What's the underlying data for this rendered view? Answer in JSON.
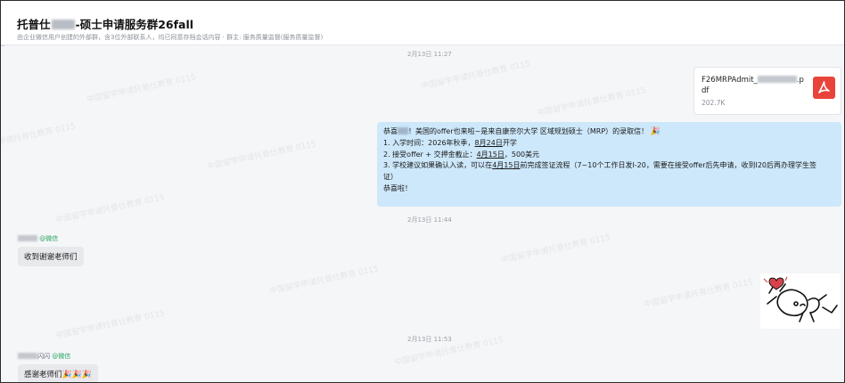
{
  "header": {
    "title_prefix": "托普仕",
    "title_suffix": "-硕士申请服务群26fall",
    "subtitle": "由企业微信用户创建的外部群，含3位外部联系人，均已同意存档会话内容 · 群主: 服务质量监督(服务质量监督)"
  },
  "watermark_text": "中国留学申请托普仕教育 0115",
  "timestamps": {
    "t1": "2月13日 11:27",
    "t2": "2月13日 11:44",
    "t3": "2月13日 11:53"
  },
  "file_message": {
    "name_prefix": "F26MRPAdmit_",
    "name_suffix": ".p",
    "name_tail": "df",
    "size": "202.7K",
    "icon": "pdf-icon"
  },
  "offer_message": {
    "line1_pre": "恭喜",
    "line1_post": "！美国的offer也来啦~是来自康奈尔大学 区域规划硕士（MRP）的录取信！",
    "line2_pre": "1. 入学时间：2026年秋季，",
    "line2_date": "8月24日",
    "line2_post": "开学",
    "line3_pre": "2. 接受offer + 交押金截止：",
    "line3_date": "4月15日",
    "line3_post": "，500美元",
    "line4_pre": "3. 学校建议如果确认入读，可以在",
    "line4_date": "4月15日",
    "line4_post": "前完成签证流程（7~10个工作日发I-20，需要在接受offer后先申请，收到I20后再办理学生签",
    "line5": "证）",
    "line6": "恭喜啦！",
    "emoji": "🎉"
  },
  "reply1": {
    "sender_suffix": "",
    "wechat_tag": "@微信",
    "text": "收到谢谢老师们"
  },
  "reply2": {
    "sender_suffix": "闪闪",
    "wechat_tag": "@微信",
    "text": "感谢老师们",
    "emojis": "🎉🎉🎉"
  },
  "colors": {
    "bubble_blue": "#cde8fb",
    "bubble_gray": "#e8e9ec",
    "pdf_red": "#e8443a",
    "wechat_green": "#25a55f"
  }
}
